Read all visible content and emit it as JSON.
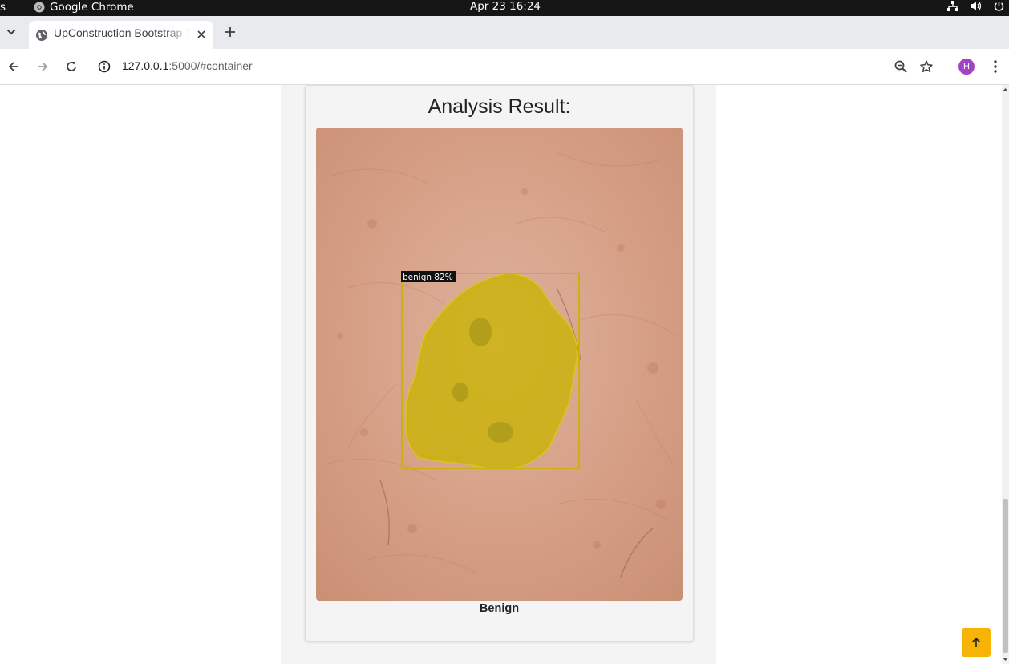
{
  "os_bar": {
    "activities_label": "s",
    "app_name": "Google Chrome",
    "clock": "Apr 23  16:24"
  },
  "browser": {
    "tab_title": "UpConstruction Bootstrap Template",
    "url_host": "127.0.0.1",
    "url_path": ":5000/#container",
    "profile_initial": "H"
  },
  "page": {
    "result_title": "Analysis Result:",
    "detection_label": "benign 82%",
    "diagnosis": "Benign"
  },
  "colors": {
    "accent": "#f7b407",
    "mask": "#c9b400",
    "skin": "#d9a084"
  },
  "icons": {
    "tab_list": "chevron-down-icon",
    "favicon": "globe-icon",
    "close": "close-icon",
    "new_tab": "plus-icon",
    "back": "arrow-left-icon",
    "forward": "arrow-right-icon",
    "reload": "reload-icon",
    "site_info": "info-icon",
    "zoom": "zoom-icon",
    "bookmark": "star-icon",
    "menu": "kebab-menu-icon",
    "back_to_top": "arrow-up-icon"
  }
}
